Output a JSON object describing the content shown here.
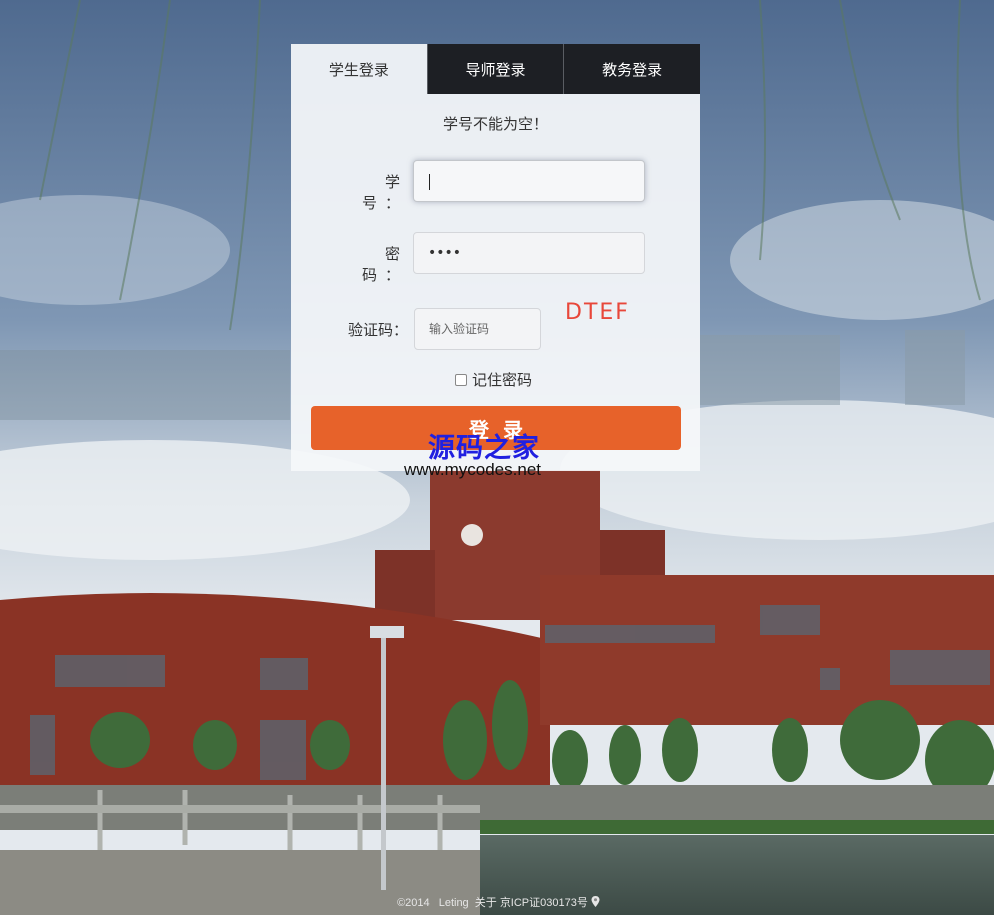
{
  "tabs": [
    {
      "label": "学生登录",
      "active": true
    },
    {
      "label": "导师登录",
      "active": false
    },
    {
      "label": "教务登录",
      "active": false
    }
  ],
  "form": {
    "error_message": "学号不能为空！",
    "student_id": {
      "label": "学 号：",
      "value": ""
    },
    "password": {
      "label": "密 码：",
      "value": "1234"
    },
    "captcha": {
      "label": "验证码：",
      "placeholder": "输入验证码",
      "code": "DTEF"
    },
    "remember_label": "记住密码",
    "remember_checked": false,
    "login_label": "登录"
  },
  "watermark": {
    "title": "源码之家",
    "url": "www.mycodes.net"
  },
  "footer": {
    "copyright": "©2014",
    "author": "Leting",
    "about": "关于",
    "icp": "京ICP证030173号"
  },
  "colors": {
    "login_button": "#e7622a",
    "captcha_text": "#e8473a",
    "tab_inactive_bg": "#1d1f24",
    "watermark_title": "#2020e0"
  }
}
